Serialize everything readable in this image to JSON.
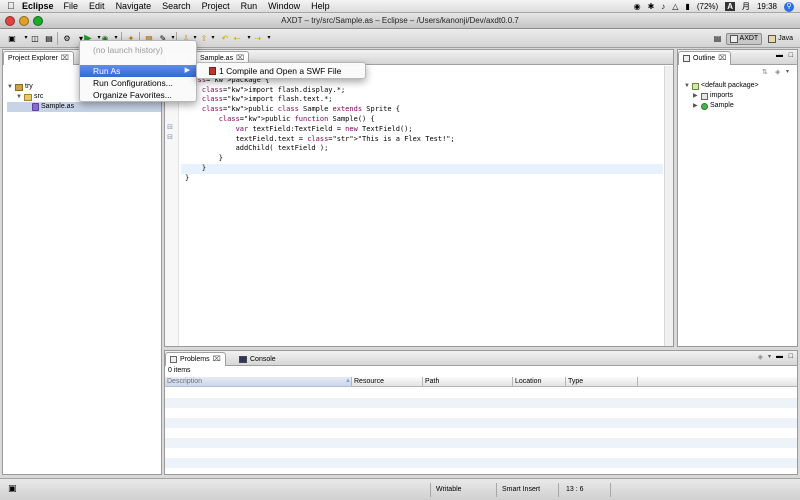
{
  "menubar": {
    "app_name": "Eclipse",
    "items": [
      "File",
      "Edit",
      "Navigate",
      "Search",
      "Project",
      "Run",
      "Window",
      "Help"
    ],
    "battery": "(72%)",
    "input_method": "A",
    "date": "月",
    "time": "19:38"
  },
  "window": {
    "title": "AXDT – try/src/Sample.as – Eclipse – /Users/kanonji/Dev/axdt0.0.7"
  },
  "perspectives": [
    {
      "label": "AXDT",
      "active": true
    },
    {
      "label": "Java",
      "active": false
    }
  ],
  "explorer": {
    "tab_label": "Project Explorer",
    "tree": [
      {
        "label": "try",
        "level": 0,
        "expanded": true,
        "icon": "project-icon"
      },
      {
        "label": "src",
        "level": 1,
        "expanded": true,
        "icon": "folder-icon"
      },
      {
        "label": "Sample.as",
        "level": 2,
        "icon": "as-file-icon",
        "selected": true
      }
    ]
  },
  "editor": {
    "tab_label": "Sample.as",
    "code_lines": [
      {
        "text": "",
        "cur": false
      },
      {
        "text": "package {",
        "cur": false
      },
      {
        "text": "    import flash.display.*;",
        "cur": false
      },
      {
        "text": "    import flash.text.*;",
        "cur": false
      },
      {
        "text": "    public class Sample extends Sprite {",
        "cur": false
      },
      {
        "text": "        public function Sample() {",
        "cur": false
      },
      {
        "text": "            var textField:TextField = new TextField();",
        "cur": false
      },
      {
        "text": "            textField.text = \"This is a Flex Test!\";",
        "cur": false
      },
      {
        "text": "            addChild( textField );",
        "cur": false
      },
      {
        "text": "        }",
        "cur": false
      },
      {
        "text": "    }",
        "cur": true
      },
      {
        "text": "}",
        "cur": false
      }
    ]
  },
  "outline": {
    "tab_label": "Outline",
    "tree": [
      {
        "label": "<default package>",
        "level": 0,
        "expanded": true
      },
      {
        "label": "imports",
        "level": 1,
        "expanded": false
      },
      {
        "label": "Sample",
        "level": 1,
        "expanded": false
      }
    ]
  },
  "problems": {
    "tab_label": "Problems",
    "console_tab_label": "Console",
    "count": "0 items",
    "columns": [
      "Description",
      "Resource",
      "Path",
      "Location",
      "Type"
    ]
  },
  "run_menu": {
    "items": [
      {
        "label": "(no launch history)",
        "disabled": true
      },
      {
        "label": "Run As",
        "highlighted": true,
        "submenu": true
      },
      {
        "label": "Run Configurations...",
        "disabled": false
      },
      {
        "label": "Organize Favorites...",
        "disabled": false
      }
    ]
  },
  "run_as_submenu": {
    "items": [
      {
        "label": "1 Compile and Open a SWF File"
      }
    ]
  },
  "statusbar": {
    "writable": "Writable",
    "insert_mode": "Smart Insert",
    "position": "13 : 6"
  },
  "colors": {
    "selection": "#3767d4",
    "keyword": "#7f0055",
    "string": "#2a00ff",
    "current_line": "#e8f2fe"
  }
}
